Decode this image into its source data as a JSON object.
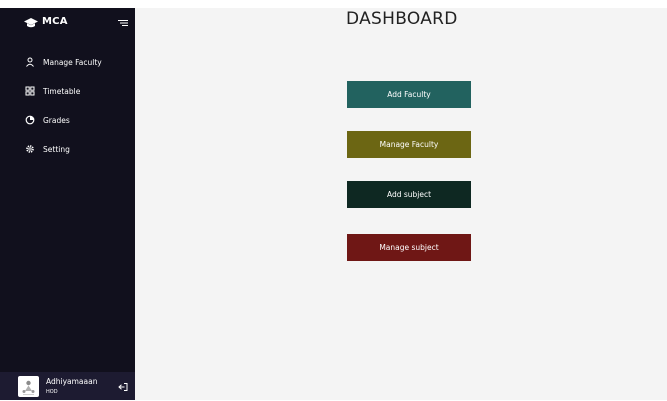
{
  "sidebar": {
    "brand": {
      "name": "MCA",
      "icon": "graduation-cap-icon"
    },
    "toggle_icon": "menu-toggle-icon",
    "items": [
      {
        "label": "Manage Faculty",
        "icon": "user-icon"
      },
      {
        "label": "Timetable",
        "icon": "grid-icon"
      },
      {
        "label": "Grades",
        "icon": "pie-chart-icon"
      },
      {
        "label": "Setting",
        "icon": "gear-icon"
      }
    ],
    "profile": {
      "name": "Adhiyamaaan",
      "role": "HOD",
      "logout_icon": "logout-icon"
    }
  },
  "main": {
    "title": "DASHBOARD",
    "buttons": [
      {
        "label": "Add Faculty",
        "color": "#22625f"
      },
      {
        "label": "Manage Faculty",
        "color": "#6c6613"
      },
      {
        "label": "Add subject",
        "color": "#0e2822"
      },
      {
        "label": "Manage subject",
        "color": "#6f1715"
      }
    ]
  },
  "colors": {
    "sidebar_bg": "#11101d",
    "page_bg": "#f4f4f4"
  }
}
